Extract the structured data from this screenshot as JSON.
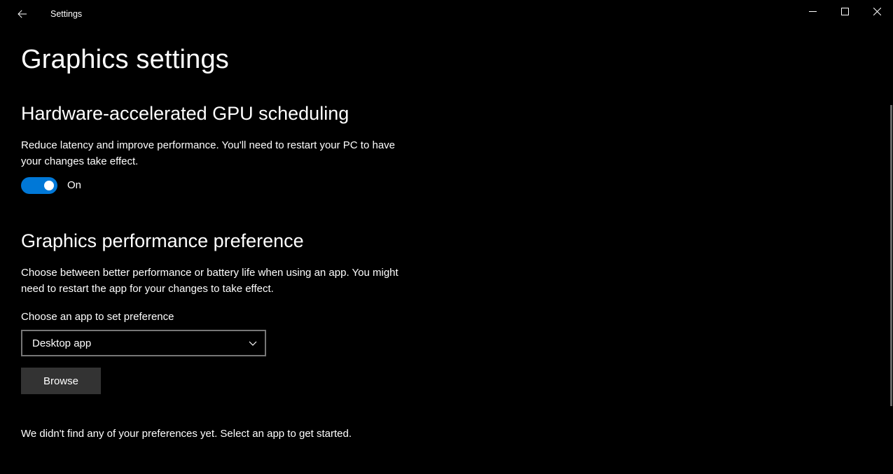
{
  "titlebar": {
    "app_title": "Settings"
  },
  "page": {
    "title": "Graphics settings"
  },
  "gpu_scheduling": {
    "heading": "Hardware-accelerated GPU scheduling",
    "description": "Reduce latency and improve performance. You'll need to restart your PC to have your changes take effect.",
    "toggle_state_label": "On",
    "toggle_on": true
  },
  "perf_pref": {
    "heading": "Graphics performance preference",
    "description": "Choose between better performance or battery life when using an app. You might need to restart the app for your changes to take effect.",
    "field_label": "Choose an app to set preference",
    "select_value": "Desktop app",
    "browse_label": "Browse",
    "empty_message": "We didn't find any of your preferences yet. Select an app to get started."
  }
}
